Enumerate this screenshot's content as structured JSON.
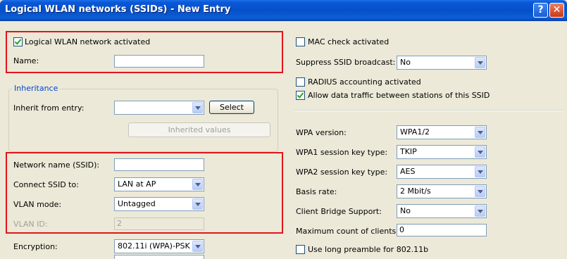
{
  "window": {
    "title": "Logical WLAN networks (SSIDs) - New Entry",
    "help_glyph": "?",
    "close_glyph": "✕"
  },
  "left": {
    "wlan_activated": {
      "label": "Logical WLAN network activated",
      "checked": true
    },
    "name": {
      "label": "Name:",
      "value": ""
    },
    "inheritance": {
      "title": "Inheritance",
      "inherit_from": {
        "label": "Inherit from entry:",
        "value": ""
      },
      "select_button": "Select",
      "inherited_values_button": "Inherited values"
    },
    "ssid": {
      "label": "Network name (SSID):",
      "value": ""
    },
    "connect_ssid": {
      "label": "Connect SSID to:",
      "value": "LAN at AP"
    },
    "vlan_mode": {
      "label": "VLAN mode:",
      "value": "Untagged"
    },
    "vlan_id": {
      "label": "VLAN ID:",
      "value": "2"
    },
    "encryption": {
      "label": "Encryption:",
      "value": "802.11i (WPA)-PSK"
    }
  },
  "right": {
    "mac_check": {
      "label": "MAC check activated",
      "checked": false
    },
    "suppress_ssid": {
      "label": "Suppress SSID broadcast:",
      "value": "No"
    },
    "radius_accounting": {
      "label": "RADIUS accounting activated",
      "checked": false
    },
    "allow_traffic": {
      "label": "Allow data traffic between stations of this SSID",
      "checked": true
    },
    "wpa_version": {
      "label": "WPA version:",
      "value": "WPA1/2"
    },
    "wpa1_key": {
      "label": "WPA1 session key type:",
      "value": "TKIP"
    },
    "wpa2_key": {
      "label": "WPA2 session key type:",
      "value": "AES"
    },
    "basis_rate": {
      "label": "Basis rate:",
      "value": "2 Mbit/s"
    },
    "client_bridge": {
      "label": "Client Bridge Support:",
      "value": "No"
    },
    "max_clients": {
      "label": "Maximum count of clients:",
      "value": "0"
    },
    "long_preamble": {
      "label": "Use long preamble for 802.11b",
      "checked": false
    }
  }
}
